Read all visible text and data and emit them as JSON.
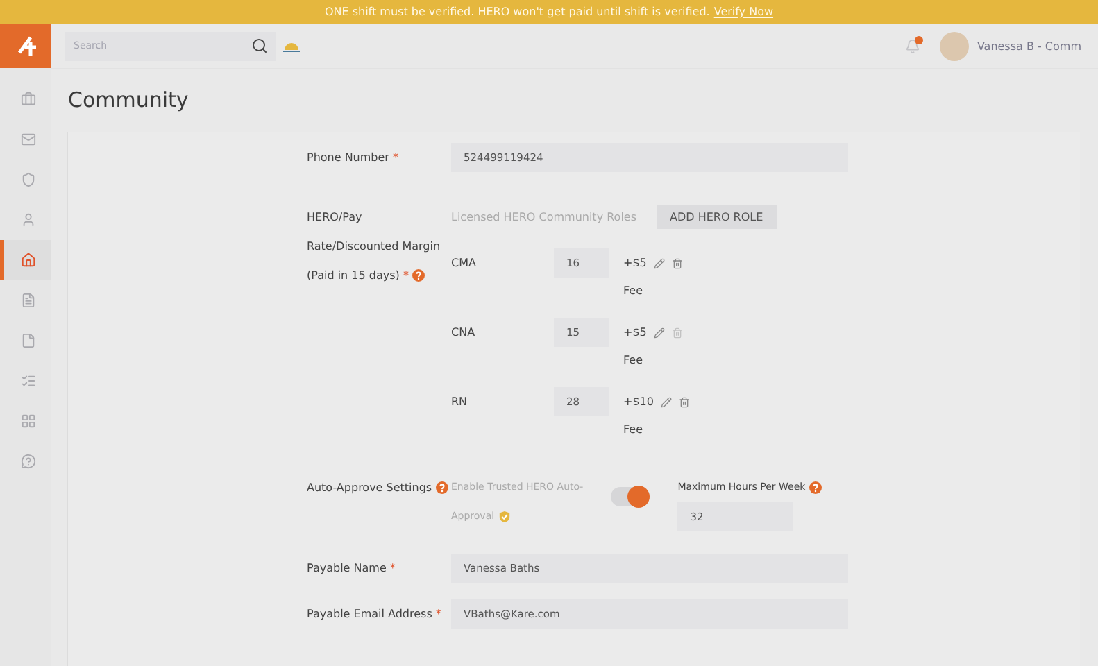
{
  "banner": {
    "text": "ONE shift must be verified. HERO won't get paid until shift is verified.",
    "link": "Verify Now"
  },
  "search": {
    "placeholder": "Search"
  },
  "user": {
    "name": "Vanessa B - Comm",
    "has_notification": true
  },
  "sidebar": {
    "items": [
      {
        "kind": "briefcase",
        "selected": false
      },
      {
        "kind": "mail",
        "selected": false
      },
      {
        "kind": "shield",
        "selected": false
      },
      {
        "kind": "person",
        "selected": false
      },
      {
        "kind": "home",
        "selected": true
      },
      {
        "kind": "doc",
        "selected": false
      },
      {
        "kind": "file",
        "selected": false
      },
      {
        "kind": "list",
        "selected": false
      },
      {
        "kind": "grid",
        "selected": false
      },
      {
        "kind": "help",
        "selected": false
      }
    ]
  },
  "page_title": "Community",
  "phone": {
    "label": "Phone Number",
    "required_mark": "*",
    "value": "524499119424"
  },
  "roles": {
    "label_lines": [
      "HERO/Pay",
      "Rate/Discounted Margin",
      "(Paid in 15 days)"
    ],
    "required_mark": "*",
    "heading": "Licensed HERO Community Roles",
    "add_button": "ADD HERO ROLE",
    "items": [
      {
        "name": "CMA",
        "rate": "16",
        "fee": "+$5",
        "fee_label": "Fee",
        "delete_enabled": true
      },
      {
        "name": "CNA",
        "rate": "15",
        "fee": "+$5",
        "fee_label": "Fee",
        "delete_enabled": false
      },
      {
        "name": "RN",
        "rate": "28",
        "fee": "+$10",
        "fee_label": "Fee",
        "delete_enabled": true
      }
    ]
  },
  "auto_approve": {
    "label": "Auto-Approve Settings",
    "toggle_label_lines": [
      "Enable Trusted HERO Auto-",
      "Approval"
    ],
    "on": true,
    "max_hours_label": "Maximum Hours Per Week",
    "max_hours": "32"
  },
  "payable_name": {
    "label": "Payable Name",
    "required_mark": "*",
    "value": "Vanessa Baths"
  },
  "payable_email": {
    "label": "Payable Email Address",
    "required_mark": "*",
    "value": "VBaths@Kare.com"
  }
}
